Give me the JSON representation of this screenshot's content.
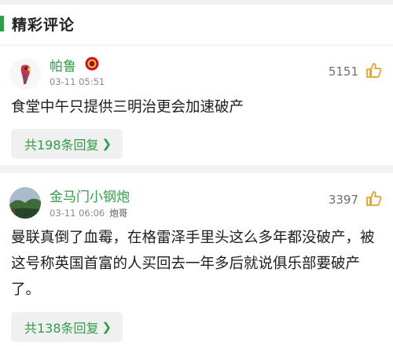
{
  "section": {
    "title": "精彩评论"
  },
  "comments": [
    {
      "username": "帕鲁",
      "time": "03-11 05:51",
      "tag": "",
      "likes": "5151",
      "text": "食堂中午只提供三明治更会加速破产",
      "replies": "共198条回复",
      "avatar_icon": "parrot-avatar",
      "badge_icon": "club-crest-badge"
    },
    {
      "username": "金马门小钢炮",
      "time": "03-11 06:06",
      "tag": "炮哥",
      "likes": "3397",
      "text": "曼联真倒了血霉，在格雷泽手里头这么多年都没破产，被这号称英国首富的人买回去一年多后就说俱乐部要破产了。",
      "replies": "共138条回复",
      "avatar_icon": "landscape-avatar"
    }
  ],
  "colors": {
    "accent": "#2e9e47",
    "muted": "#8a8a8a",
    "thumb": "#e3a12f"
  }
}
